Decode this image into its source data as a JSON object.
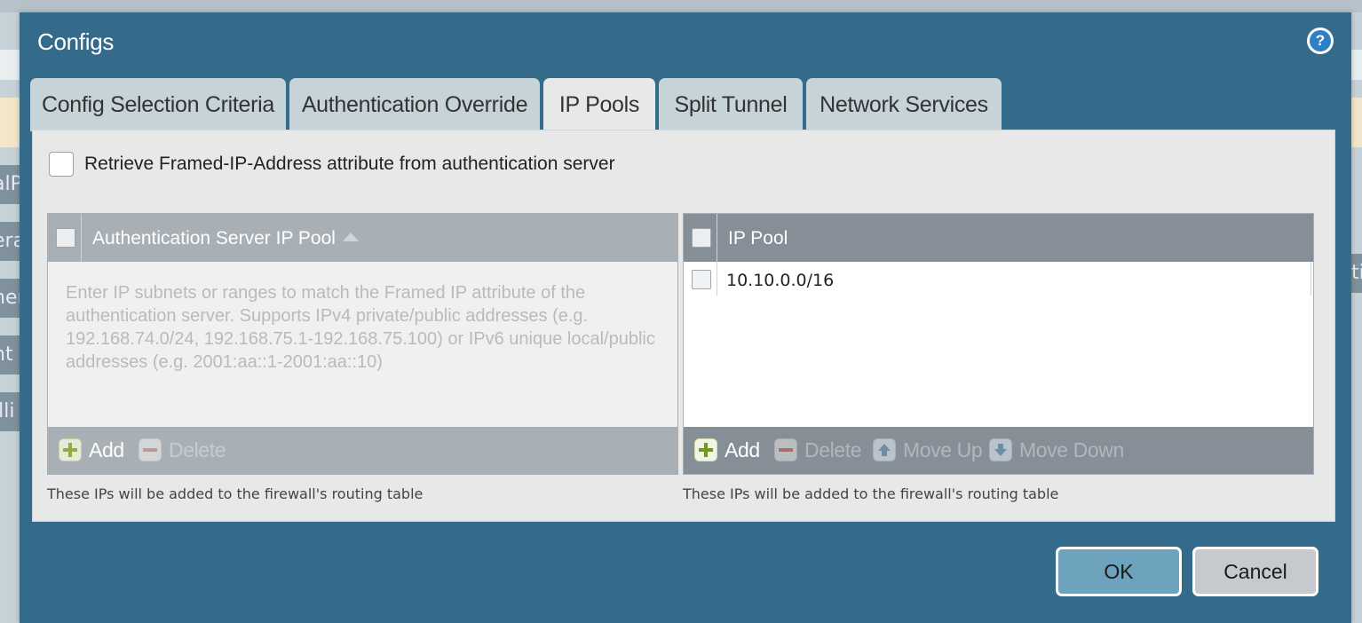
{
  "background": {
    "fragments": [
      "alP",
      "era",
      "her",
      "nt",
      "ılli"
    ],
    "fragments_right": [
      "ti"
    ]
  },
  "dialog": {
    "title": "Configs",
    "help_icon": "help-icon",
    "tabs": [
      {
        "label": "Config Selection Criteria",
        "active": false
      },
      {
        "label": "Authentication Override",
        "active": false
      },
      {
        "label": "IP Pools",
        "active": true
      },
      {
        "label": "Split Tunnel",
        "active": false
      },
      {
        "label": "Network Services",
        "active": false
      }
    ],
    "retrieve_checkbox": {
      "label": "Retrieve Framed-IP-Address attribute from authentication server",
      "checked": false
    },
    "auth_pool": {
      "header": "Authentication Server IP Pool",
      "placeholder": "Enter IP subnets or ranges to match the Framed IP attribute of the authentication server. Supports IPv4 private/public addresses (e.g. 192.168.74.0/24, 192.168.75.1-192.168.75.100) or IPv6 unique local/public addresses (e.g. 2001:aa::1-2001:aa::10)",
      "add_label": "Add",
      "delete_label": "Delete",
      "hint": "These IPs will be added to the firewall's routing table"
    },
    "ip_pool": {
      "header": "IP Pool",
      "rows": [
        "10.10.0.0/16"
      ],
      "add_label": "Add",
      "delete_label": "Delete",
      "move_up_label": "Move Up",
      "move_down_label": "Move Down",
      "hint": "These IPs will be added to the firewall's routing table"
    },
    "ok_label": "OK",
    "cancel_label": "Cancel"
  },
  "colors": {
    "dialog_bg": "#346a8a",
    "tab_inactive": "#c6d3d8",
    "tab_active": "#e8e8e8",
    "grid_header_disabled": "#a9b0b5",
    "grid_header_active": "#868f97",
    "ok_button": "#6ea3bd",
    "cancel_button": "#c6c9cd"
  }
}
